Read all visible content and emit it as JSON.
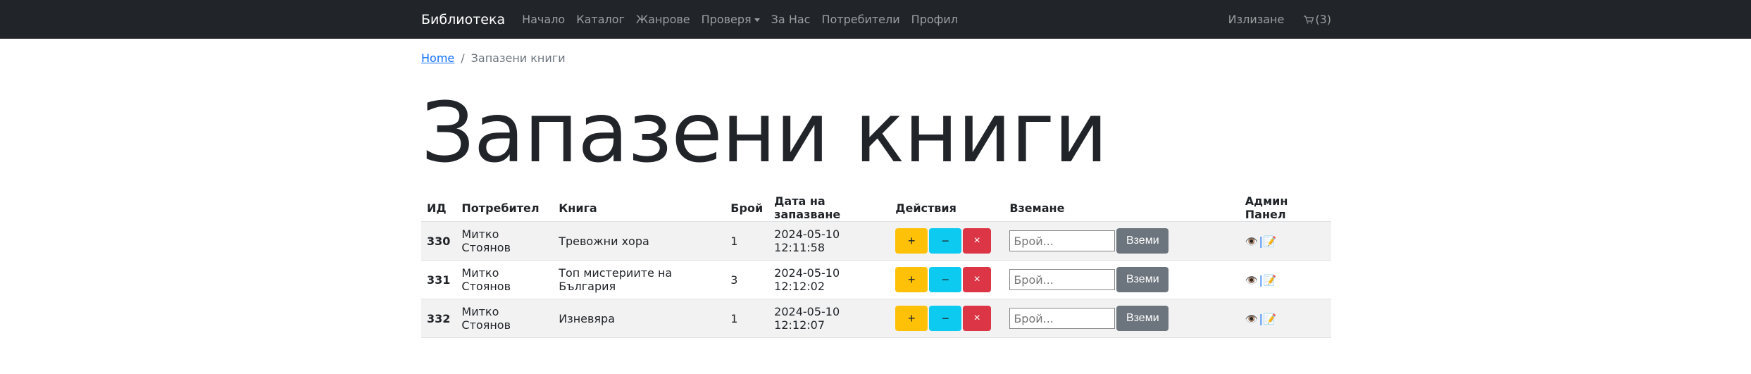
{
  "navbar": {
    "brand": "Библиотека",
    "links": [
      {
        "label": "Начало"
      },
      {
        "label": "Каталог"
      },
      {
        "label": "Жанрове"
      },
      {
        "label": "Проверя"
      },
      {
        "label": "За Нас"
      },
      {
        "label": "Потребители"
      },
      {
        "label": "Профил"
      }
    ],
    "logout": "Излизане",
    "cart": "(3)"
  },
  "breadcrumb": {
    "home": "Home",
    "separator": "/",
    "current": "Запазени книги"
  },
  "page_title": "Запазени книги",
  "table": {
    "headers": [
      "ИД",
      "Потребител",
      "Книга",
      "Брой",
      "Дата на запазване",
      "Действия",
      "Вземане",
      "Админ Панел"
    ],
    "rows": [
      {
        "id": "330",
        "user": "Митко Стоянов",
        "book": "Тревожни хора",
        "count": "1",
        "date": "2024-05-10 12:11:58"
      },
      {
        "id": "331",
        "user": "Митко Стоянов",
        "book": "Топ мистериите на България",
        "count": "3",
        "date": "2024-05-10 12:12:02"
      },
      {
        "id": "332",
        "user": "Митко Стоянов",
        "book": "Изневяра",
        "count": "1",
        "date": "2024-05-10 12:12:07"
      }
    ],
    "actions": {
      "plus": "+",
      "minus": "−",
      "remove": "×"
    },
    "take": {
      "placeholder": "Брой...",
      "button": "Вземи"
    },
    "admin": {
      "view_icon": "eye-icon",
      "edit_icon": "pencil-icon",
      "separator": "|"
    }
  },
  "colors": {
    "navbar_bg": "#212529",
    "plus": "#ffc107",
    "minus": "#0dcaf0",
    "remove": "#dc3545",
    "take": "#6c757d",
    "link": "#0d6efd"
  }
}
